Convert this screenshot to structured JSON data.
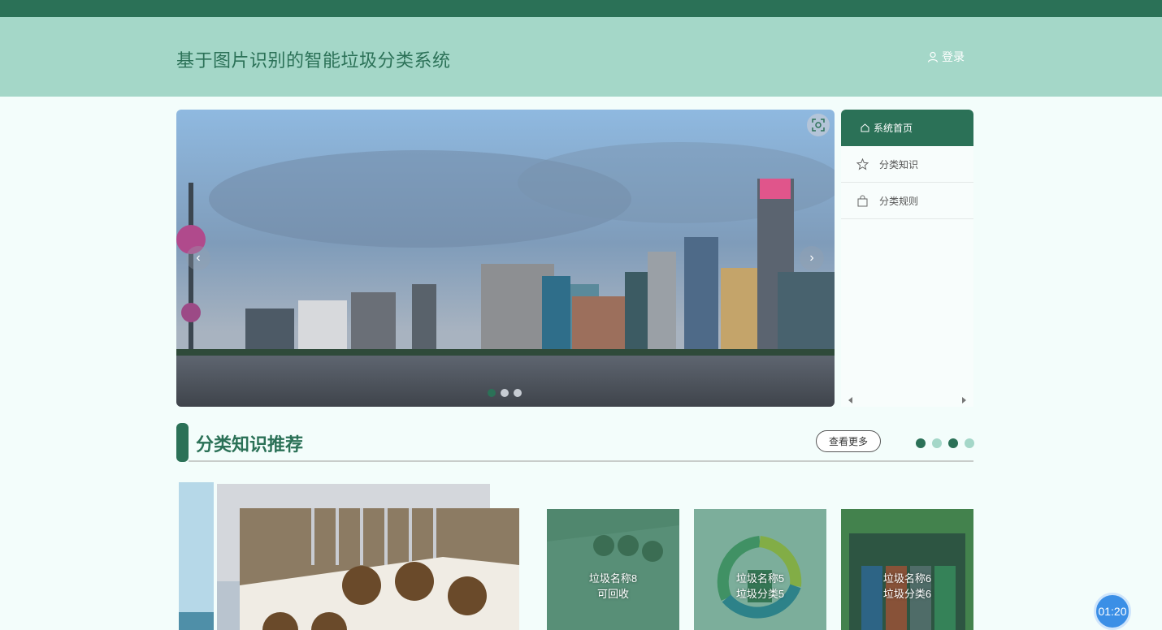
{
  "header": {
    "title": "基于图片识别的智能垃圾分类系统",
    "login_label": "登录"
  },
  "carousel": {
    "prev_icon": "chevron-left-icon",
    "next_icon": "chevron-right-icon",
    "indicator_count": 3,
    "active_indicator": 0
  },
  "side_menu": {
    "items": [
      {
        "label": "系统首页",
        "icon": "home-icon",
        "active": true
      },
      {
        "label": "分类知识",
        "icon": "star-icon",
        "active": false
      },
      {
        "label": "分类规则",
        "icon": "bag-icon",
        "active": false
      }
    ]
  },
  "section": {
    "title": "分类知识推荐",
    "more_label": "查看更多",
    "dot_colors": [
      "#2b7157",
      "#a4d7c8",
      "#2b7157",
      "#a4d7c8"
    ]
  },
  "cards": [
    {
      "name_line": "垃圾名称8",
      "category_line": "可回收"
    },
    {
      "name_line": "垃圾名称5",
      "category_line": "垃圾分类5"
    },
    {
      "name_line": "垃圾名称6",
      "category_line": "垃圾分类6"
    }
  ],
  "timer": "01:20",
  "colors": {
    "primary": "#2b7157",
    "header_bg": "#a4d7c8",
    "page_bg": "#f3fdfb"
  }
}
